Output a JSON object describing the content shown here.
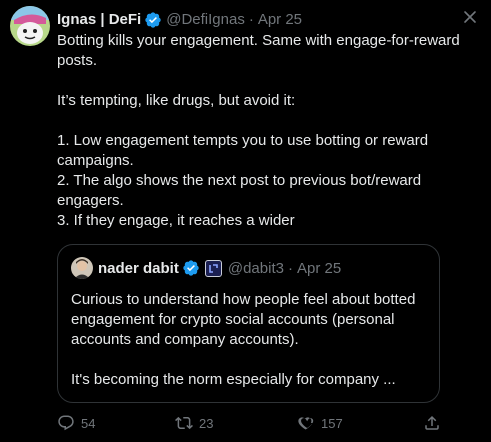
{
  "tweet": {
    "author_name": "Ignas | DeFi",
    "author_handle": "@DefiIgnas",
    "separator": "·",
    "date": "Apr 25",
    "text": "Botting kills your engagement. Same with engage-for-reward posts.\n\nIt’s tempting, like drugs, but avoid it:\n\n1. Low engagement tempts you to use botting or reward campaigns.\n2. The algo shows the next post to previous bot/reward engagers.\n3. If they engage, it reaches a wider"
  },
  "quote": {
    "author_name": "nader dabit",
    "author_handle": "@dabit3",
    "separator": "·",
    "date": "Apr 25",
    "text": "Curious to understand how people feel about botted engagement for crypto social accounts (personal accounts and company accounts).\n\nIt's becoming the norm especially for company ..."
  },
  "actions": {
    "replies": "54",
    "reposts": "23",
    "likes": "157"
  },
  "colors": {
    "background": "#000000",
    "text": "#e7e9ea",
    "muted": "#71767b",
    "verified": "#1d9bf0",
    "border": "#2f3336"
  },
  "icons": [
    "close-icon",
    "verified-badge-icon",
    "reply-icon",
    "repost-icon",
    "like-icon",
    "share-icon"
  ]
}
